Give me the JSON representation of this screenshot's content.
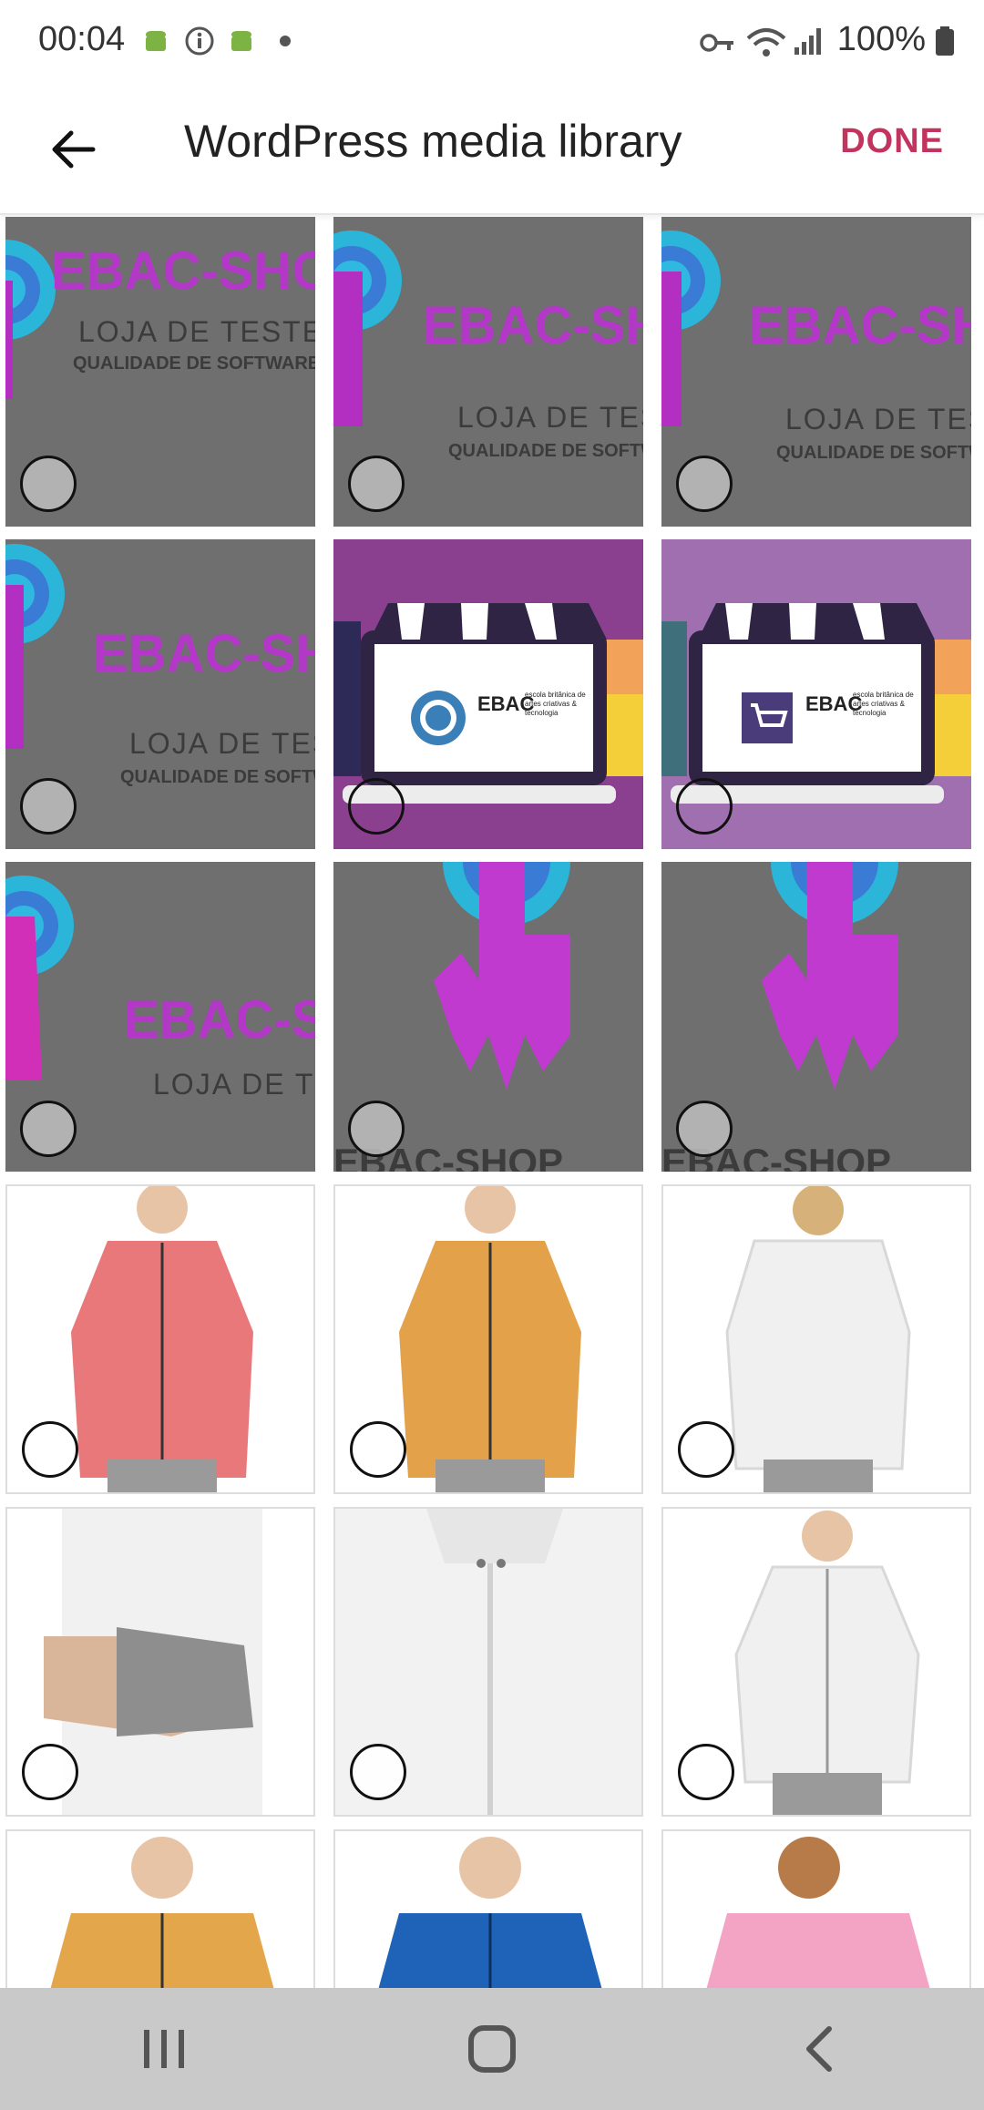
{
  "status_bar": {
    "time": "00:04",
    "battery": "100%",
    "icons": [
      "android-icon",
      "info-icon",
      "android-icon",
      "dot-icon",
      "key-icon",
      "wifi-icon",
      "signal-icon",
      "battery-icon"
    ]
  },
  "app_bar": {
    "title": "WordPress media library",
    "done_label": "DONE",
    "accent": "#c2335d"
  },
  "media": {
    "logo_title": "EBAC-SHOP",
    "logo_subtitle": "LOJA DE TESTES",
    "logo_caption": "QUALIDADE DE SOFTWARE",
    "logo_title_short": "EBAC-SI",
    "logo_title_short2": "EBAC-S",
    "logo_sub_short": "LOJA DE TE",
    "logo_bottom": "EBAC-SHOP",
    "ebac_brand": "EBAC",
    "ebac_tagline": "escola britânica de artes criativas & tecnologia",
    "items": [
      {
        "kind": "logo",
        "selected": false
      },
      {
        "kind": "logo",
        "selected": false
      },
      {
        "kind": "logo",
        "selected": false
      },
      {
        "kind": "logo",
        "selected": false
      },
      {
        "kind": "shop-illustration",
        "selected": false
      },
      {
        "kind": "shop-illustration",
        "selected": false
      },
      {
        "kind": "logo",
        "selected": false
      },
      {
        "kind": "hand-icon",
        "selected": false
      },
      {
        "kind": "hand-icon",
        "selected": false
      },
      {
        "kind": "photo",
        "subject": "pink jacket",
        "color": "#e8787a",
        "selected": false
      },
      {
        "kind": "photo",
        "subject": "orange jacket",
        "color": "#e3a24a",
        "selected": false
      },
      {
        "kind": "photo",
        "subject": "white jacket back",
        "color": "#f0f0f0",
        "selected": false
      },
      {
        "kind": "photo",
        "subject": "grey thumbhole sleeve",
        "color": "#8e8e8e",
        "selected": false
      },
      {
        "kind": "photo",
        "subject": "white jacket back detail",
        "color": "#ececec",
        "selected": false
      },
      {
        "kind": "photo",
        "subject": "white jacket front",
        "color": "#efefef",
        "selected": false
      },
      {
        "kind": "photo",
        "subject": "orange zip top",
        "color": "#e4a64a",
        "selected": false
      },
      {
        "kind": "photo",
        "subject": "blue zip top",
        "color": "#1e63b8",
        "selected": false
      },
      {
        "kind": "photo",
        "subject": "pink zip top",
        "color": "#f3a4c4",
        "selected": false
      }
    ]
  },
  "nav_bar": {
    "buttons": [
      "recent-apps-icon",
      "home-icon",
      "back-nav-icon"
    ]
  }
}
